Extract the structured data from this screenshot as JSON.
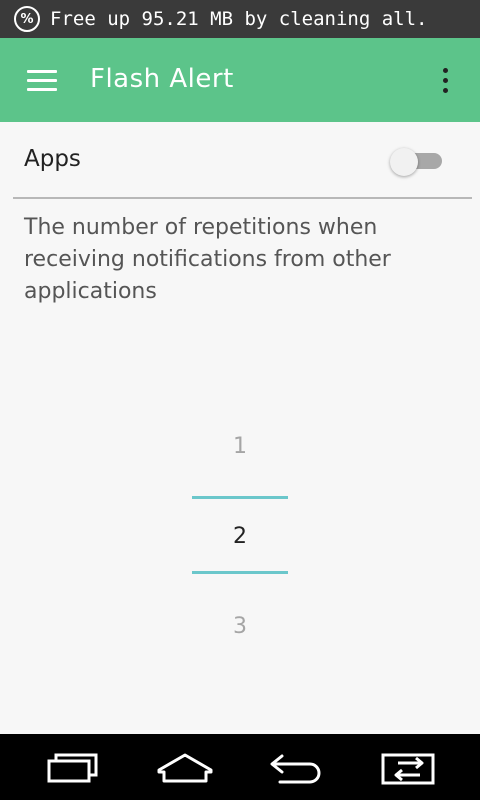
{
  "status_bar": {
    "icon": "percent-icon",
    "icon_glyph": "%",
    "notification": "Free up 95.21 MB by cleaning all."
  },
  "app_bar": {
    "title": "Flash Alert",
    "menu_icon": "hamburger-menu-icon",
    "more_icon": "more-vert-icon",
    "color": "#5cc48a"
  },
  "apps_setting": {
    "label": "Apps",
    "enabled": false
  },
  "description": "The number of repetitions when receiving notifications from other applications",
  "picker": {
    "values": [
      "1",
      "2",
      "3"
    ],
    "selected": "2",
    "accent": "#6bc7cb"
  },
  "nav_bar": {
    "buttons": [
      "recent-apps-icon",
      "home-icon",
      "back-icon",
      "switch-apps-icon"
    ]
  }
}
